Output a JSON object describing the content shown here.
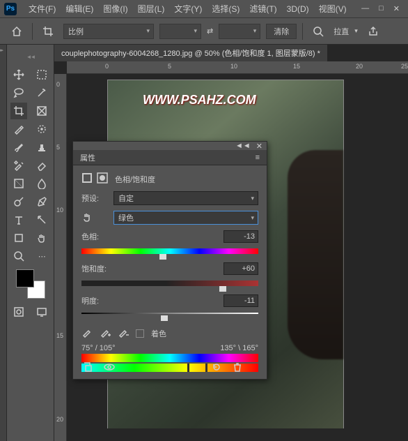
{
  "app": {
    "logo": "Ps"
  },
  "menu": {
    "file": "文件(F)",
    "edit": "编辑(E)",
    "image": "图像(I)",
    "layer": "图层(L)",
    "type": "文字(Y)",
    "select": "选择(S)",
    "filter": "滤镜(T)",
    "threed": "3D(D)",
    "view": "视图(V)"
  },
  "optbar": {
    "ratio": "比例",
    "clear": "清除",
    "straighten": "拉直"
  },
  "tab": {
    "title": "couplephotography-6004268_1280.jpg @ 50% (色相/饱和度 1, 图层蒙版/8) *"
  },
  "ruler": {
    "h0": "0",
    "h5": "5",
    "h10": "10",
    "h15": "15",
    "h20": "20",
    "h25": "25",
    "v0": "0",
    "v5": "5",
    "v10": "10",
    "v15": "15",
    "v20": "20"
  },
  "watermark": "WWW.PSAHZ.COM",
  "panel": {
    "tab_title": "属性",
    "adjustment": "色相/饱和度",
    "preset_label": "预设:",
    "preset_value": "自定",
    "channel_value": "绿色",
    "hue_label": "色相:",
    "hue_value": "-13",
    "sat_label": "饱和度:",
    "sat_value": "+60",
    "light_label": "明度:",
    "light_value": "-11",
    "colorize": "着色",
    "range_left": "75° / 105°",
    "range_right": "135° \\ 165°"
  },
  "chart_data": {
    "type": "table",
    "title": "Hue/Saturation Adjustment",
    "rows": [
      {
        "param": "色相",
        "value": -13,
        "range": [
          -180,
          180
        ]
      },
      {
        "param": "饱和度",
        "value": 60,
        "range": [
          -100,
          100
        ]
      },
      {
        "param": "明度",
        "value": -11,
        "range": [
          -100,
          100
        ]
      }
    ],
    "channel": "绿色",
    "color_range_deg": [
      75,
      105,
      135,
      165
    ]
  }
}
